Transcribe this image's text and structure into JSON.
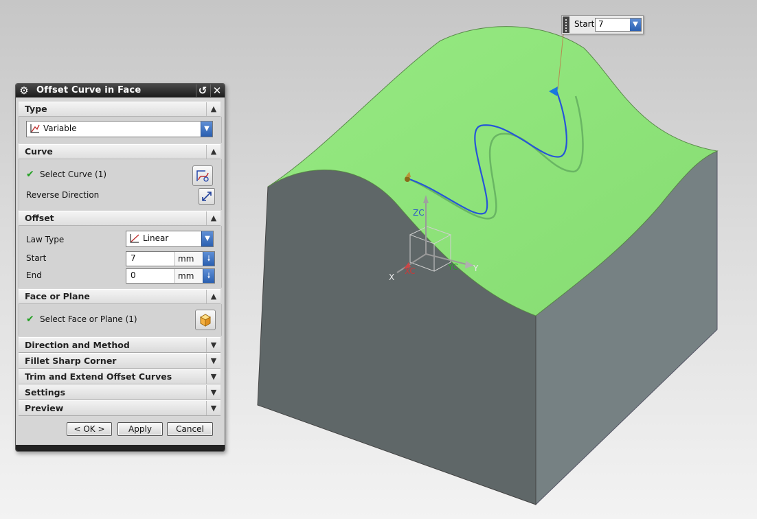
{
  "dialog": {
    "title": "Offset Curve in Face",
    "type_section": {
      "label": "Type",
      "selected": "Variable"
    },
    "curve_section": {
      "label": "Curve",
      "select_curve": "Select Curve (1)",
      "reverse_direction": "Reverse Direction"
    },
    "offset_section": {
      "label": "Offset",
      "law_type_label": "Law Type",
      "law_type_value": "Linear",
      "start_label": "Start",
      "start_value": "7",
      "start_unit": "mm",
      "end_label": "End",
      "end_value": "0",
      "end_unit": "mm"
    },
    "face_section": {
      "label": "Face or Plane",
      "select_face": "Select Face or Plane (1)"
    },
    "collapsed_sections": [
      "Direction and Method",
      "Fillet Sharp Corner",
      "Trim and Extend Offset Curves",
      "Settings",
      "Preview"
    ],
    "buttons": {
      "ok": "< OK >",
      "apply": "Apply",
      "cancel": "Cancel"
    }
  },
  "floating_input": {
    "label": "Start",
    "value": "7"
  },
  "axes": {
    "zc": "ZC",
    "yc": "YC",
    "xc": "XC",
    "x": "X",
    "y": "Y"
  },
  "colors": {
    "face_top": "#8fe57b",
    "body_front": "#5f6768",
    "body_side": "#768183",
    "curve": "#2555d8"
  }
}
